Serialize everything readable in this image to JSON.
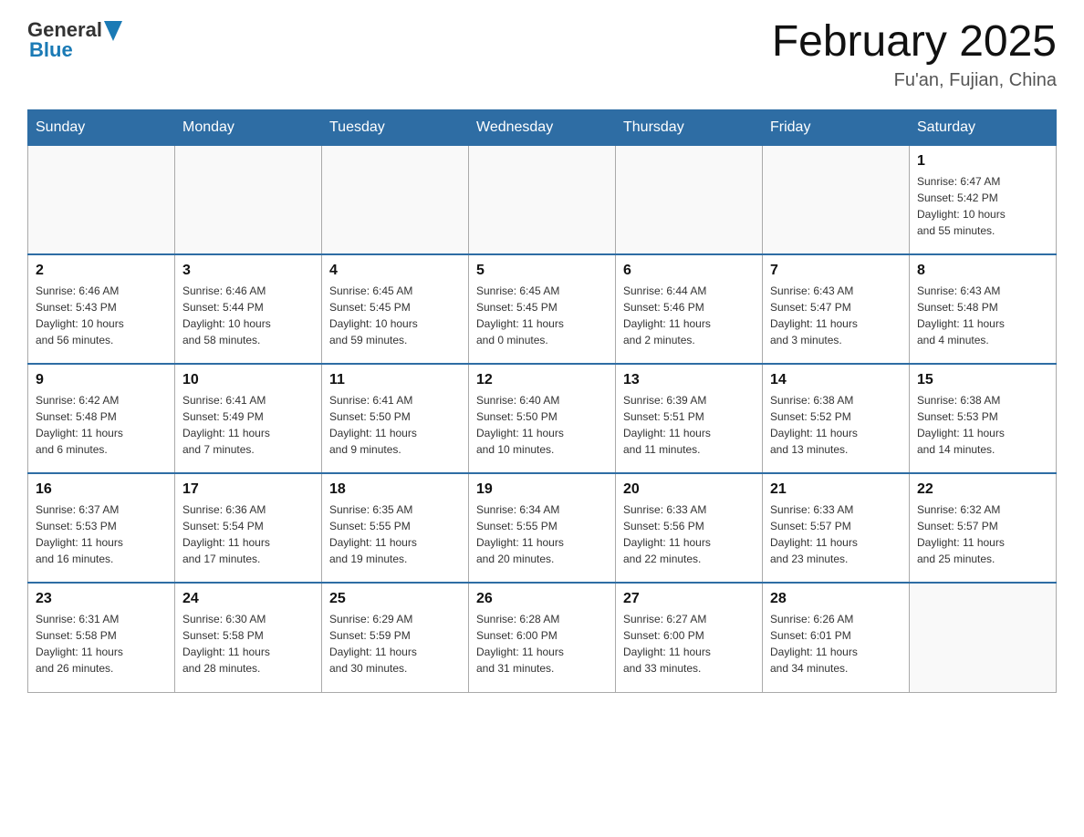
{
  "header": {
    "logo_general": "General",
    "logo_blue": "Blue",
    "title": "February 2025",
    "subtitle": "Fu'an, Fujian, China"
  },
  "days_of_week": [
    "Sunday",
    "Monday",
    "Tuesday",
    "Wednesday",
    "Thursday",
    "Friday",
    "Saturday"
  ],
  "weeks": [
    [
      {
        "day": "",
        "info": ""
      },
      {
        "day": "",
        "info": ""
      },
      {
        "day": "",
        "info": ""
      },
      {
        "day": "",
        "info": ""
      },
      {
        "day": "",
        "info": ""
      },
      {
        "day": "",
        "info": ""
      },
      {
        "day": "1",
        "info": "Sunrise: 6:47 AM\nSunset: 5:42 PM\nDaylight: 10 hours\nand 55 minutes."
      }
    ],
    [
      {
        "day": "2",
        "info": "Sunrise: 6:46 AM\nSunset: 5:43 PM\nDaylight: 10 hours\nand 56 minutes."
      },
      {
        "day": "3",
        "info": "Sunrise: 6:46 AM\nSunset: 5:44 PM\nDaylight: 10 hours\nand 58 minutes."
      },
      {
        "day": "4",
        "info": "Sunrise: 6:45 AM\nSunset: 5:45 PM\nDaylight: 10 hours\nand 59 minutes."
      },
      {
        "day": "5",
        "info": "Sunrise: 6:45 AM\nSunset: 5:45 PM\nDaylight: 11 hours\nand 0 minutes."
      },
      {
        "day": "6",
        "info": "Sunrise: 6:44 AM\nSunset: 5:46 PM\nDaylight: 11 hours\nand 2 minutes."
      },
      {
        "day": "7",
        "info": "Sunrise: 6:43 AM\nSunset: 5:47 PM\nDaylight: 11 hours\nand 3 minutes."
      },
      {
        "day": "8",
        "info": "Sunrise: 6:43 AM\nSunset: 5:48 PM\nDaylight: 11 hours\nand 4 minutes."
      }
    ],
    [
      {
        "day": "9",
        "info": "Sunrise: 6:42 AM\nSunset: 5:48 PM\nDaylight: 11 hours\nand 6 minutes."
      },
      {
        "day": "10",
        "info": "Sunrise: 6:41 AM\nSunset: 5:49 PM\nDaylight: 11 hours\nand 7 minutes."
      },
      {
        "day": "11",
        "info": "Sunrise: 6:41 AM\nSunset: 5:50 PM\nDaylight: 11 hours\nand 9 minutes."
      },
      {
        "day": "12",
        "info": "Sunrise: 6:40 AM\nSunset: 5:50 PM\nDaylight: 11 hours\nand 10 minutes."
      },
      {
        "day": "13",
        "info": "Sunrise: 6:39 AM\nSunset: 5:51 PM\nDaylight: 11 hours\nand 11 minutes."
      },
      {
        "day": "14",
        "info": "Sunrise: 6:38 AM\nSunset: 5:52 PM\nDaylight: 11 hours\nand 13 minutes."
      },
      {
        "day": "15",
        "info": "Sunrise: 6:38 AM\nSunset: 5:53 PM\nDaylight: 11 hours\nand 14 minutes."
      }
    ],
    [
      {
        "day": "16",
        "info": "Sunrise: 6:37 AM\nSunset: 5:53 PM\nDaylight: 11 hours\nand 16 minutes."
      },
      {
        "day": "17",
        "info": "Sunrise: 6:36 AM\nSunset: 5:54 PM\nDaylight: 11 hours\nand 17 minutes."
      },
      {
        "day": "18",
        "info": "Sunrise: 6:35 AM\nSunset: 5:55 PM\nDaylight: 11 hours\nand 19 minutes."
      },
      {
        "day": "19",
        "info": "Sunrise: 6:34 AM\nSunset: 5:55 PM\nDaylight: 11 hours\nand 20 minutes."
      },
      {
        "day": "20",
        "info": "Sunrise: 6:33 AM\nSunset: 5:56 PM\nDaylight: 11 hours\nand 22 minutes."
      },
      {
        "day": "21",
        "info": "Sunrise: 6:33 AM\nSunset: 5:57 PM\nDaylight: 11 hours\nand 23 minutes."
      },
      {
        "day": "22",
        "info": "Sunrise: 6:32 AM\nSunset: 5:57 PM\nDaylight: 11 hours\nand 25 minutes."
      }
    ],
    [
      {
        "day": "23",
        "info": "Sunrise: 6:31 AM\nSunset: 5:58 PM\nDaylight: 11 hours\nand 26 minutes."
      },
      {
        "day": "24",
        "info": "Sunrise: 6:30 AM\nSunset: 5:58 PM\nDaylight: 11 hours\nand 28 minutes."
      },
      {
        "day": "25",
        "info": "Sunrise: 6:29 AM\nSunset: 5:59 PM\nDaylight: 11 hours\nand 30 minutes."
      },
      {
        "day": "26",
        "info": "Sunrise: 6:28 AM\nSunset: 6:00 PM\nDaylight: 11 hours\nand 31 minutes."
      },
      {
        "day": "27",
        "info": "Sunrise: 6:27 AM\nSunset: 6:00 PM\nDaylight: 11 hours\nand 33 minutes."
      },
      {
        "day": "28",
        "info": "Sunrise: 6:26 AM\nSunset: 6:01 PM\nDaylight: 11 hours\nand 34 minutes."
      },
      {
        "day": "",
        "info": ""
      }
    ]
  ]
}
